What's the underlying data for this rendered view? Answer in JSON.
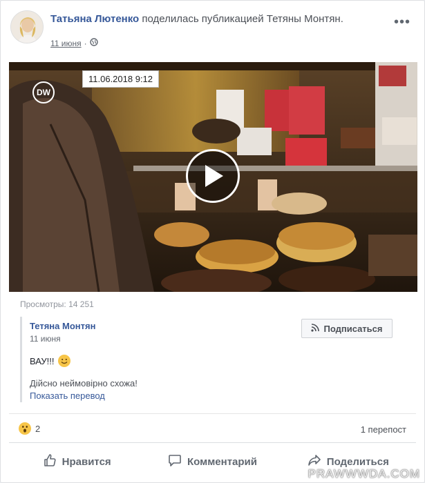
{
  "post": {
    "author": "Татьяна Лютенко",
    "shared_text": " поделилась публикацией Тетяны Монтян.",
    "date": "11 июня",
    "separator": "·",
    "more_icon": "more-dots-icon",
    "privacy_icon": "globe-icon"
  },
  "video": {
    "timestamp": "11.06.2018 9:12",
    "logo_text": "DW",
    "play_icon": "play-icon"
  },
  "views": "Просмотры: 14 251",
  "quote": {
    "author": "Тетяна Монтян",
    "date": "11 июня",
    "subscribe_label": "Подписаться",
    "body": "ВАУ!!!",
    "text": "Дійсно неймовірно схожа!",
    "translate_label": "Показать перевод"
  },
  "reactions": {
    "count": "2",
    "shares": "1 перепост",
    "icon": "wow-reaction-icon"
  },
  "actions": {
    "like": "Нравится",
    "comment": "Комментарий",
    "share": "Поделиться"
  },
  "watermark": "PRAWWWDA.COM",
  "colors": {
    "link": "#365899",
    "muted": "#616770",
    "action_text": "#606770"
  }
}
